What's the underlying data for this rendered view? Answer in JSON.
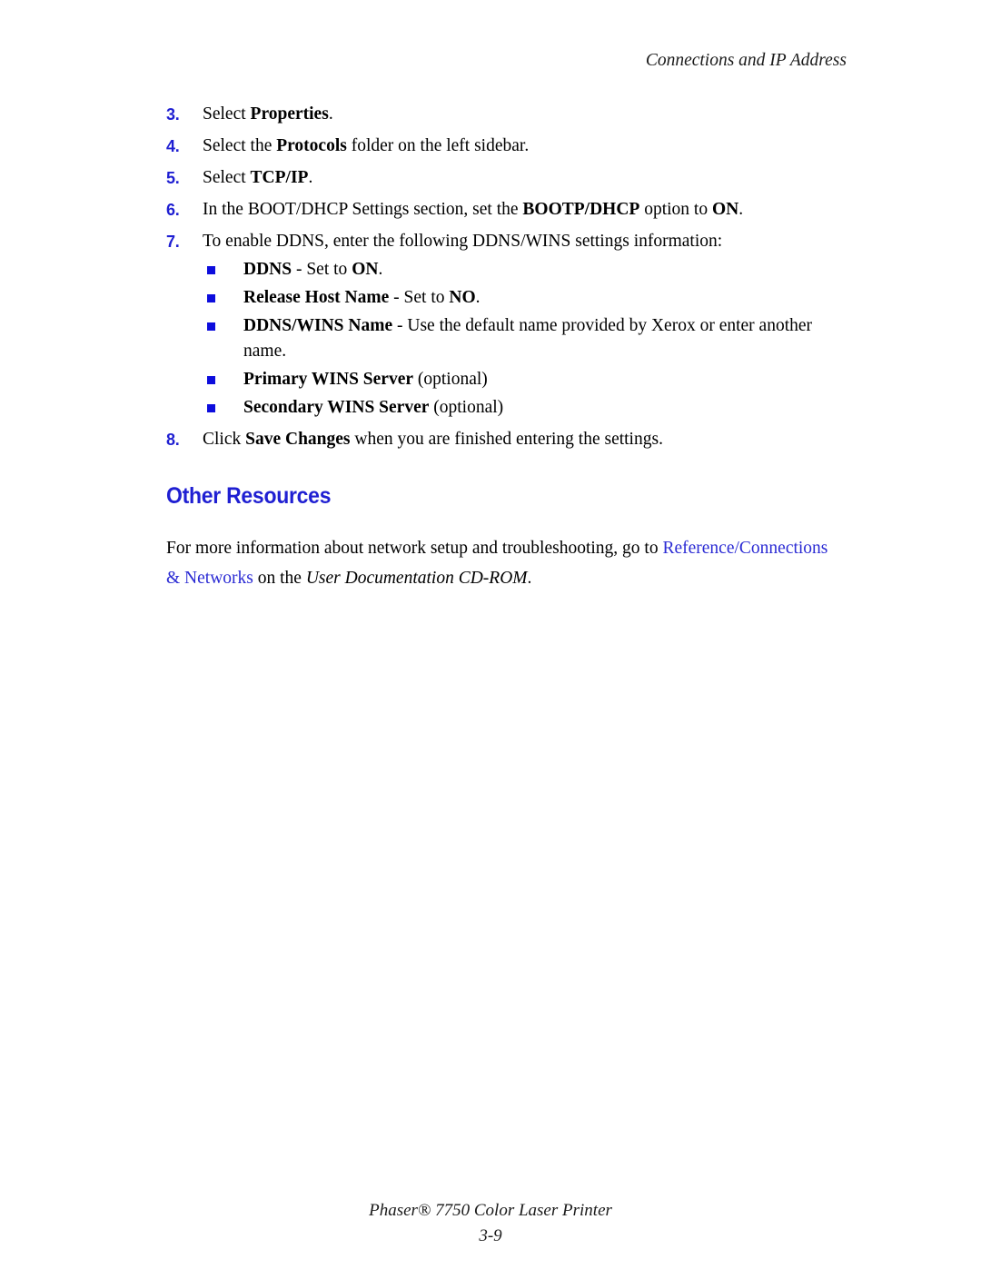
{
  "header": {
    "running_title": "Connections and IP Address"
  },
  "steps": [
    {
      "number": "3.",
      "parts": [
        {
          "text": "Select ",
          "style": "normal"
        },
        {
          "text": "Properties",
          "style": "bold"
        },
        {
          "text": ".",
          "style": "normal"
        }
      ]
    },
    {
      "number": "4.",
      "parts": [
        {
          "text": "Select the ",
          "style": "normal"
        },
        {
          "text": "Protocols",
          "style": "bold"
        },
        {
          "text": " folder on the left sidebar.",
          "style": "normal"
        }
      ]
    },
    {
      "number": "5.",
      "parts": [
        {
          "text": "Select ",
          "style": "normal"
        },
        {
          "text": "TCP/IP",
          "style": "bold"
        },
        {
          "text": ".",
          "style": "normal"
        }
      ]
    },
    {
      "number": "6.",
      "parts": [
        {
          "text": "In the BOOT/DHCP Settings section, set the ",
          "style": "normal"
        },
        {
          "text": "BOOTP/DHCP",
          "style": "bold"
        },
        {
          "text": " option to ",
          "style": "normal"
        },
        {
          "text": "ON",
          "style": "bold"
        },
        {
          "text": ".",
          "style": "normal"
        }
      ]
    },
    {
      "number": "7.",
      "parts": [
        {
          "text": "To enable DDNS, enter the following DDNS/WINS settings information:",
          "style": "normal"
        }
      ]
    }
  ],
  "bullets": [
    {
      "parts": [
        {
          "text": "DDNS",
          "style": "bold"
        },
        {
          "text": " - Set to ",
          "style": "normal"
        },
        {
          "text": "ON",
          "style": "bold"
        },
        {
          "text": ".",
          "style": "normal"
        }
      ]
    },
    {
      "parts": [
        {
          "text": "Release Host Name",
          "style": "bold"
        },
        {
          "text": " - Set to ",
          "style": "normal"
        },
        {
          "text": "NO",
          "style": "bold"
        },
        {
          "text": ".",
          "style": "normal"
        }
      ]
    },
    {
      "parts": [
        {
          "text": "DDNS/WINS Name",
          "style": "bold"
        },
        {
          "text": " - Use the default name provided by Xerox or enter another name.",
          "style": "normal"
        }
      ]
    },
    {
      "parts": [
        {
          "text": "Primary WINS Server",
          "style": "bold"
        },
        {
          "text": " (optional)",
          "style": "normal"
        }
      ]
    },
    {
      "parts": [
        {
          "text": "Secondary WINS Server",
          "style": "bold"
        },
        {
          "text": " (optional)",
          "style": "normal"
        }
      ]
    }
  ],
  "final_step": {
    "number": "8.",
    "parts": [
      {
        "text": "Click ",
        "style": "normal"
      },
      {
        "text": "Save Changes",
        "style": "bold"
      },
      {
        "text": " when you are finished entering the settings.",
        "style": "normal"
      }
    ]
  },
  "section": {
    "heading": "Other Resources",
    "paragraph_parts": [
      {
        "text": "For more information about network setup and troubleshooting, go to ",
        "style": "normal"
      },
      {
        "text": "Reference/Connections & Networks",
        "style": "link"
      },
      {
        "text": " on the ",
        "style": "normal"
      },
      {
        "text": "User Documentation CD-ROM",
        "style": "italic"
      },
      {
        "text": ".",
        "style": "normal"
      }
    ]
  },
  "footer": {
    "product": "Phaser® 7750 Color Laser Printer",
    "page_number": "3-9"
  },
  "colors": {
    "step_number_blue": "#1f1fd2",
    "bullet_blue": "#0d0ddd",
    "heading_blue": "#1f1fd2",
    "link_blue": "#2b2bd4",
    "text_black": "#000000",
    "page_background": "#ffffff"
  }
}
